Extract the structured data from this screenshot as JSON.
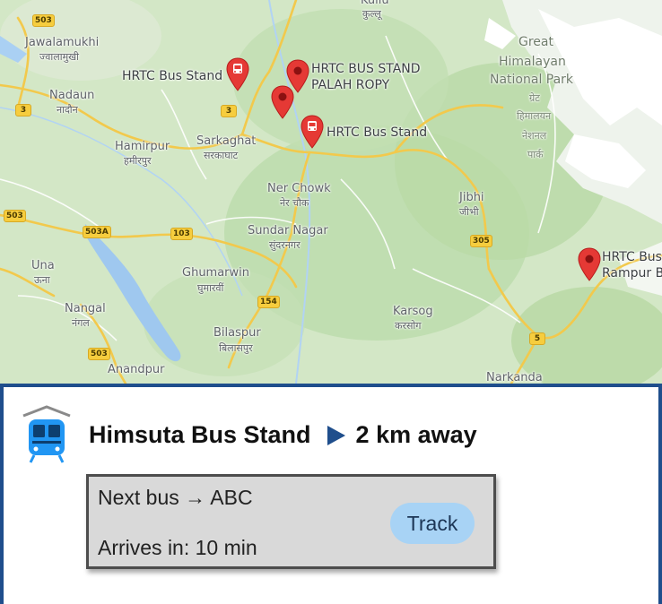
{
  "map": {
    "places": {
      "jawalamukhi": "Jawalamukhi",
      "jawalamukhi_hi": "ज्वालामुखी",
      "nadaun": "Nadaun",
      "nadaun_hi": "नादौन",
      "hamirpur": "Hamirpur",
      "hamirpur_hi": "हमीरपुर",
      "sarkaghat": "Sarkaghat",
      "sarkaghat_hi": "सरकाघाट",
      "ner_chowk": "Ner Chowk",
      "ner_chowk_hi": "नेर चौक",
      "sundar_nagar": "Sundar Nagar",
      "sundar_nagar_hi": "सुंदरनगर",
      "ghumarwin": "Ghumarwin",
      "ghumarwin_hi": "घुमारवीं",
      "una": "Una",
      "una_hi": "ऊना",
      "nangal": "Nangal",
      "nangal_hi": "नंगल",
      "bilaspur": "Bilaspur",
      "bilaspur_hi": "बिलासपुर",
      "anandpur": "Anandpur",
      "jibhi": "Jibhi",
      "jibhi_hi": "जीभी",
      "karsog": "Karsog",
      "karsog_hi": "करसोग",
      "narkanda": "Narkanda",
      "kullu": "Kullu",
      "kullu_hi": "कुल्लू",
      "park_line1": "Great",
      "park_line2": "Himalayan",
      "park_line3": "National Park",
      "park_hi1": "ग्रेट",
      "park_hi2": "हिमालयन",
      "park_hi3": "नेशनल",
      "park_hi4": "पार्क"
    },
    "stops": {
      "stop1": "HRTC Bus Stand",
      "stop2_line1": "HRTC BUS STAND",
      "stop2_line2": "PALAH ROPY",
      "stop3": "HRTC Bus Stand",
      "stop4_line1": "HRTC Bus",
      "stop4_line2": "Rampur B"
    },
    "road_shields": {
      "r503_top": "503",
      "r3_left": "3",
      "r3_mid": "3",
      "r503_left": "503",
      "r503a": "503A",
      "r103": "103",
      "r154": "154",
      "r503_bottom": "503",
      "r305": "305",
      "r5": "5"
    },
    "marker_color": "#e53935"
  },
  "panel": {
    "icon": "bus-icon",
    "stand_name": "Himsuta Bus Stand",
    "direction_icon": "play-arrow-icon",
    "distance": "2 km away",
    "next_bus": "Next bus → ABC",
    "arrival": "Arrives in: 10 min",
    "track_label": "Track",
    "accent_color": "#1f4e8c",
    "button_color": "#a8d3f5"
  }
}
